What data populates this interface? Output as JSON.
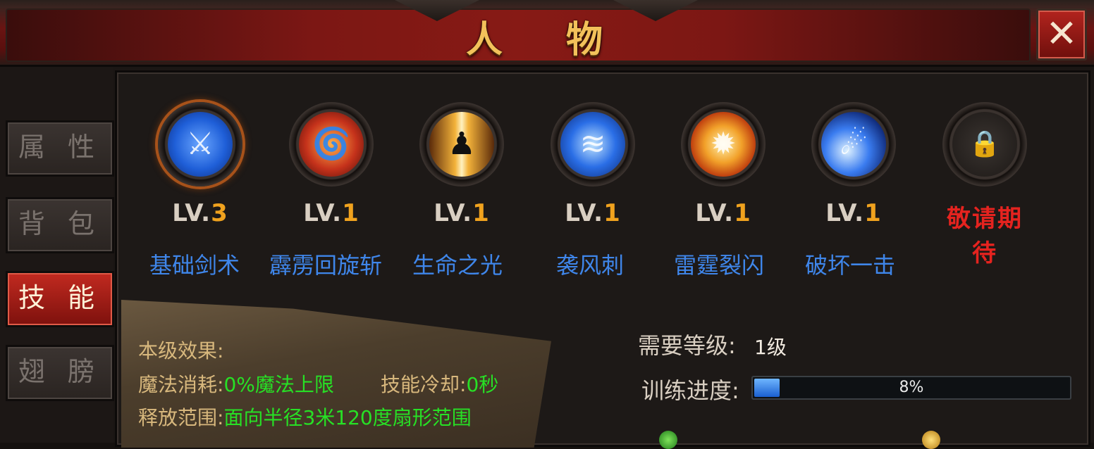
{
  "window": {
    "title": "人 物",
    "close_label": "✕"
  },
  "tabs": [
    {
      "label": "属 性",
      "active": false
    },
    {
      "label": "背 包",
      "active": false
    },
    {
      "label": "技 能",
      "active": true
    },
    {
      "label": "翅 膀",
      "active": false
    }
  ],
  "skills": [
    {
      "level_prefix": "LV.",
      "level": "3",
      "name": "基础剑术",
      "icon": "sword-icon",
      "color": "#1f5fd8"
    },
    {
      "level_prefix": "LV.",
      "level": "1",
      "name": "霹雳回旋斩",
      "icon": "vortex-icon",
      "color": "#c5321b"
    },
    {
      "level_prefix": "LV.",
      "level": "1",
      "name": "生命之光",
      "icon": "light-figure-icon",
      "color": "#d07a1c"
    },
    {
      "level_prefix": "LV.",
      "level": "1",
      "name": "袭风刺",
      "icon": "wind-slash-icon",
      "color": "#2a6ee6"
    },
    {
      "level_prefix": "LV.",
      "level": "1",
      "name": "雷霆裂闪",
      "icon": "explosion-icon",
      "color": "#e9781b"
    },
    {
      "level_prefix": "LV.",
      "level": "1",
      "name": "破坏一击",
      "icon": "comet-icon",
      "color": "#1e4fcf"
    },
    {
      "coming_soon": "敬请期待",
      "icon": "lock-icon",
      "color": "#2b2623"
    }
  ],
  "effect": {
    "title": "本级效果:",
    "mana_label": "魔法消耗:",
    "mana_value": "0%魔法上限",
    "cooldown_label": "技能冷却:",
    "cooldown_value": "0秒",
    "range_label": "释放范围:",
    "range_value": "面向半径3米120度扇形范围"
  },
  "requirements": {
    "level_label": "需要等级:",
    "level_value": "1级",
    "progress_label": "训练进度:",
    "progress_percent": 8,
    "progress_text": "8%"
  },
  "colors": {
    "accent_gold": "#f3c15a",
    "skill_name": "#3f86ea",
    "green": "#27e025",
    "red": "#e5231f"
  }
}
